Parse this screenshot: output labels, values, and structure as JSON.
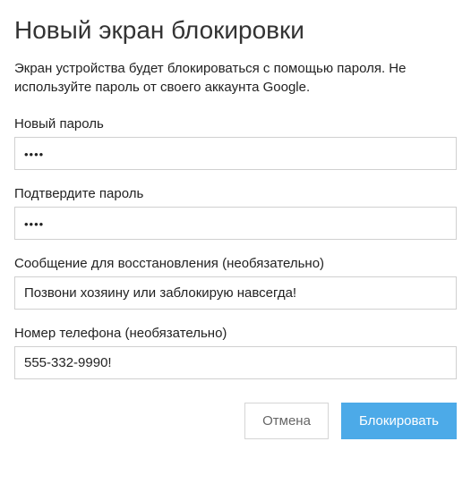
{
  "title": "Новый экран блокировки",
  "subtitle": "Экран устройства будет блокироваться с помощью пароля. Не используйте пароль от своего аккаунта Google.",
  "fields": {
    "newPassword": {
      "label": "Новый пароль",
      "value": "••••"
    },
    "confirmPassword": {
      "label": "Подтвердите пароль",
      "value": "••••"
    },
    "recoveryMessage": {
      "label": "Сообщение для восстановления (необязательно)",
      "value": "Позвони хозяину или заблокирую навсегда!"
    },
    "phoneNumber": {
      "label": "Номер телефона (необязательно)",
      "value": "555-332-9990!"
    }
  },
  "buttons": {
    "cancel": "Отмена",
    "lock": "Блокировать"
  }
}
